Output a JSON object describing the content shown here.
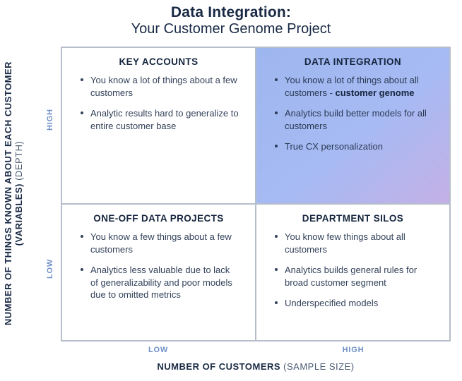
{
  "title": "Data Integration:",
  "subtitle": "Your Customer Genome Project",
  "y_axis": {
    "label_strong": "NUMBER OF THINGS KNOWN ABOUT\nEACH CUSTOMER (VARIABLES)",
    "label_light": " (DEPTH)",
    "tick_high": "HIGH",
    "tick_low": "LOW"
  },
  "x_axis": {
    "label_strong": "NUMBER OF CUSTOMERS",
    "label_light": " (SAMPLE SIZE)",
    "tick_low": "LOW",
    "tick_high": "HIGH"
  },
  "quadrants": {
    "tl": {
      "heading": "KEY ACCOUNTS",
      "bullets": [
        "You know a lot of things about a few customers",
        "Analytic results hard to generalize to entire customer base"
      ]
    },
    "tr": {
      "heading": "DATA INTEGRATION",
      "bullet1_prefix": "You know a lot of things about all customers - ",
      "bullet1_bold": "customer genome",
      "bullets_rest": [
        "Analytics build better models for all customers",
        "True CX personalization"
      ]
    },
    "bl": {
      "heading": "ONE-OFF DATA PROJECTS",
      "bullets": [
        "You know a few things about a few customers",
        "Analytics less valuable due to lack of generalizability and poor models due to omitted metrics"
      ]
    },
    "br": {
      "heading": "DEPARTMENT SILOS",
      "bullets": [
        "You know few things about all customers",
        "Analytics builds general rules for broad customer segment",
        "Underspecified models"
      ]
    }
  }
}
